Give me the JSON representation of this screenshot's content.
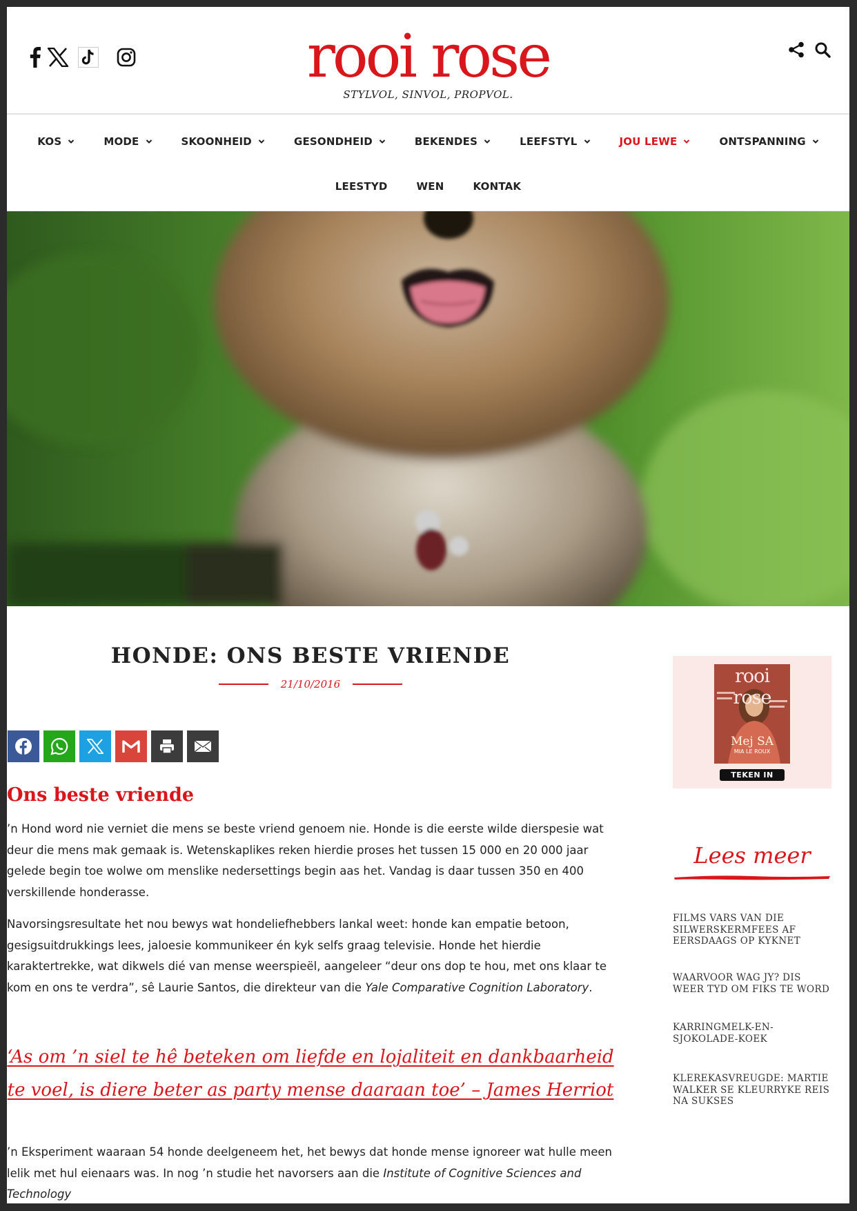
{
  "brand": {
    "logo": "rooi rose",
    "tagline": "STYLVOL, SINVOL, PROPVOL.",
    "accent_color": "#d9161c"
  },
  "header": {
    "social_icons": [
      "facebook-icon",
      "x-icon",
      "tiktok-icon",
      "instagram-icon"
    ],
    "right_icons": [
      "share-icon",
      "search-icon"
    ]
  },
  "nav": {
    "row1": [
      {
        "label": "KOS",
        "dropdown": true
      },
      {
        "label": "MODE",
        "dropdown": true
      },
      {
        "label": "SKOONHEID",
        "dropdown": true
      },
      {
        "label": "GESONDHEID",
        "dropdown": true
      },
      {
        "label": "BEKENDES",
        "dropdown": true
      },
      {
        "label": "LEEFSTYL",
        "dropdown": true
      },
      {
        "label": "JOU LEWE",
        "dropdown": true,
        "active": true
      },
      {
        "label": "ONTSPANNING",
        "dropdown": true
      }
    ],
    "row2": [
      {
        "label": "LEESTYD"
      },
      {
        "label": "WEN"
      },
      {
        "label": "KONTAK"
      }
    ]
  },
  "article": {
    "title": "HONDE: ONS BESTE VRIENDE",
    "date": "21/10/2016",
    "share_buttons": [
      {
        "name": "facebook",
        "color": "#3b5998"
      },
      {
        "name": "whatsapp",
        "color": "#25a71a"
      },
      {
        "name": "x",
        "color": "#1da1e2"
      },
      {
        "name": "gmail",
        "color": "#d9453a"
      },
      {
        "name": "print",
        "color": "#3c3c3c"
      },
      {
        "name": "email",
        "color": "#3c3c3c"
      }
    ],
    "subheading": "Ons beste vriende",
    "p1": "’n Hond word nie verniet die mens se beste vriend genoem nie. Honde is die eerste wilde dierspesie wat deur die mens mak gemaak is. Wetenskaplikes reken hierdie proses het tussen 15 000 en 20 000 jaar gelede begin toe wolwe om menslike nedersettings begin aas het. Vandag is daar tussen 350 en 400 verskillende honderasse.",
    "p2_text": "Navorsingsresultate het nou bewys wat hondeliefhebbers lankal weet: honde kan empatie betoon, gesigsuitdrukkings lees, jaloesie kommunikeer én kyk selfs graag televisie. Honde het hierdie karaktertrekke, wat dikwels dié van mense weerspieël, aangeleer “deur ons dop te hou, met ons klaar te kom en ons te verdra”, sê Laurie Santos, die direkteur van die ",
    "p2_em": "Yale Comparative Cognition Laboratory",
    "p2_end": ".",
    "quote": "‘As om ’n siel te hê beteken om liefde en lojaliteit en dankbaarheid te voel, is diere beter as party mense daaraan toe’ – James Herriot",
    "p3_text": "’n Eksperiment waaraan 54 honde deelgeneem het, het bewys dat honde mense ignoreer wat hulle meen lelik met hul eienaars was. In nog ’n studie het navorsers aan die ",
    "p3_em": "Institute of Cognitive Sciences and Technology"
  },
  "sidebar": {
    "promo": {
      "cover_brand": "rooi rose",
      "cover_name": "Mej SA",
      "cover_sub": "MIA LE ROUX",
      "button": "TEKEN IN"
    },
    "lees_meer": "Lees meer",
    "links": [
      "FILMS VARS VAN DIE SILWERSKERMFEES AF EERSDAAGS OP KYKNET",
      "WAARVOOR WAG JY? DIS WEER TYD OM FIKS TE WORD",
      "KARRINGMELK-EN-SJOKOLADE-KOEK",
      "KLEREKASVREUGDE: MARTIE WALKER SE KLEURRYKE REIS NA SUKSES"
    ]
  }
}
